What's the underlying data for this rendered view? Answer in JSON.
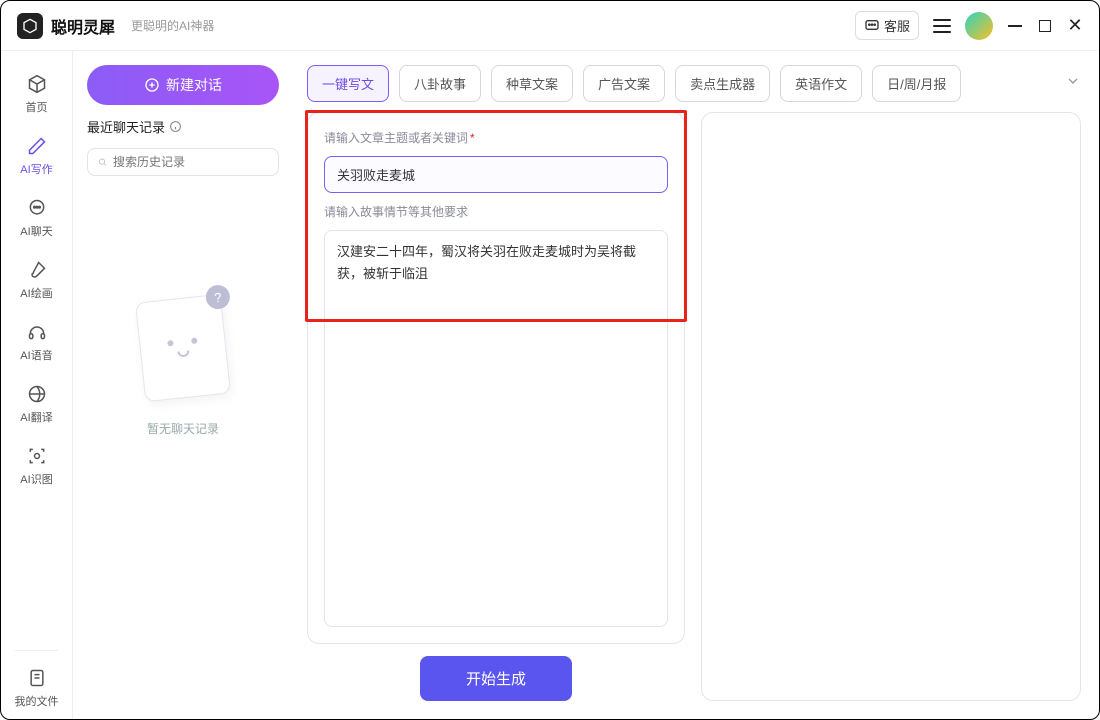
{
  "titlebar": {
    "appName": "聪明灵犀",
    "tagline": "更聪明的AI神器",
    "supportLabel": "客服"
  },
  "sidebar": {
    "items": [
      {
        "label": "首页",
        "icon": "home"
      },
      {
        "label": "AI写作",
        "icon": "pen"
      },
      {
        "label": "AI聊天",
        "icon": "chat"
      },
      {
        "label": "AI绘画",
        "icon": "brush"
      },
      {
        "label": "AI语音",
        "icon": "mic"
      },
      {
        "label": "AI翻译",
        "icon": "translate"
      },
      {
        "label": "AI识图",
        "icon": "scan"
      }
    ],
    "footer": {
      "label": "我的文件",
      "icon": "file"
    }
  },
  "recent": {
    "newChat": "新建对话",
    "heading": "最近聊天记录",
    "searchPlaceholder": "搜索历史记录",
    "emptyText": "暂无聊天记录"
  },
  "chips": [
    "一键写文",
    "八卦故事",
    "种草文案",
    "广告文案",
    "卖点生成器",
    "英语作文",
    "日/周/月报"
  ],
  "form": {
    "label1": "请输入文章主题或者关键词",
    "value1": "关羽败走麦城",
    "label2": "请输入故事情节等其他要求",
    "value2": "汉建安二十四年，蜀汉将关羽在败走麦城时为吴将截获，被斩于临沮",
    "generate": "开始生成"
  }
}
